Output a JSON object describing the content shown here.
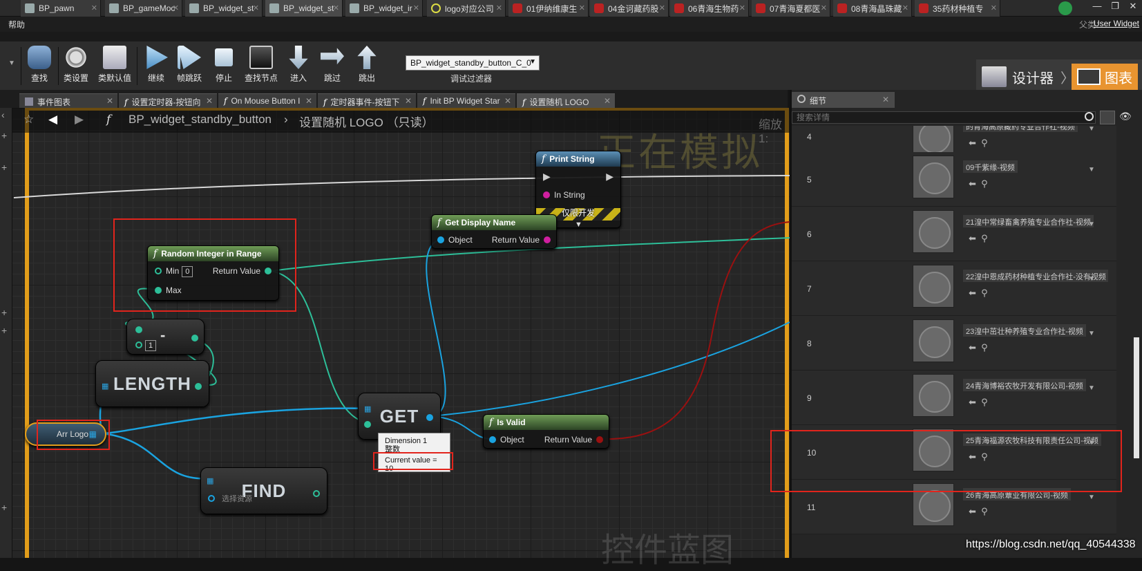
{
  "top_tabs": [
    {
      "label": "BP_pawn",
      "icon": "blueprint-icon"
    },
    {
      "label": "BP_gameMoc",
      "icon": "blueprint-icon"
    },
    {
      "label": "BP_widget_st",
      "icon": "widget-blueprint-icon"
    },
    {
      "label": "BP_widget_st",
      "icon": "widget-blueprint-icon"
    },
    {
      "label": "BP_widget_ir",
      "icon": "widget-blueprint-icon"
    },
    {
      "label": "logo对应公司",
      "icon": "ring-icon"
    },
    {
      "label": "01伊纳维康生",
      "icon": "texture-icon"
    },
    {
      "label": "04金诃藏药股",
      "icon": "texture-icon"
    },
    {
      "label": "06青海生物药",
      "icon": "texture-icon"
    },
    {
      "label": "07青海夏都医",
      "icon": "texture-icon"
    },
    {
      "label": "08青海晶珠藏",
      "icon": "texture-icon"
    },
    {
      "label": "35药材种植专",
      "icon": "texture-icon"
    }
  ],
  "menu": {
    "help": "帮助",
    "parent_label": "父类：",
    "parent_value": "User Widget"
  },
  "toolbar": {
    "buttons": [
      {
        "label": "查找",
        "icon": "binoculars-icon"
      },
      {
        "label": "类设置",
        "icon": "gear-icon"
      },
      {
        "label": "类默认值",
        "icon": "checklist-icon"
      },
      {
        "label": "继续",
        "icon": "play-icon"
      },
      {
        "label": "帧跳跃",
        "icon": "step-frame-icon"
      },
      {
        "label": "停止",
        "icon": "stop-icon"
      },
      {
        "label": "查找节点",
        "icon": "find-node-icon"
      },
      {
        "label": "进入",
        "icon": "step-into-icon"
      },
      {
        "label": "跳过",
        "icon": "step-over-icon"
      },
      {
        "label": "跳出",
        "icon": "step-out-icon"
      }
    ],
    "debug_filter_value": "BP_widget_standby_button_C_0",
    "debug_filter_label": "调试过滤器",
    "mode_designer": "设计器",
    "mode_graph": "图表"
  },
  "doc_tabs": [
    "事件图表",
    "设置定时器-按钮向",
    "On Mouse Button I",
    "定时器事件-按钮下",
    "Init BP Widget Star",
    "设置随机 LOGO"
  ],
  "graph": {
    "breadcrumb_class": "BP_widget_standby_button",
    "breadcrumb_function": "设置随机 LOGO （只读）",
    "zoom": "缩放1:",
    "watermark_simulating": "正在模拟",
    "watermark_bottom": "控件蓝图",
    "nodes": {
      "print_string": {
        "title": "Print String",
        "pin_in": "In String",
        "dev_only": "仅限开发"
      },
      "get_display_name": {
        "title": "Get Display Name",
        "pin_in": "Object",
        "pin_out": "Return Value"
      },
      "random_integer": {
        "title": "Random Integer in Range",
        "pin_min": "Min",
        "min_value": "0",
        "pin_max": "Max",
        "pin_out": "Return Value"
      },
      "subtract": {
        "symbol": "-",
        "value": "1"
      },
      "length": {
        "label": "LENGTH"
      },
      "get": {
        "label": "GET"
      },
      "is_valid": {
        "title": "Is Valid",
        "pin_in": "Object",
        "pin_out": "Return Value"
      },
      "find": {
        "label": "FIND",
        "placeholder": "选择资源"
      },
      "arr_logo": {
        "label": "Arr Logo"
      }
    },
    "tooltip": {
      "line1": "Dimension 1",
      "line2": "整数",
      "current": "Current value = 10"
    }
  },
  "details": {
    "tab": "细节",
    "search_placeholder": "搜索详情",
    "rows": [
      {
        "index": "4",
        "value": "的青海高原藏药专业合作社-视频"
      },
      {
        "index": "5",
        "value": "09千紫缘-视频"
      },
      {
        "index": "6",
        "value": "21湟中常绿畜禽养殖专业合作社-视频"
      },
      {
        "index": "7",
        "value": "22湟中恩成药材种植专业合作社-没有视频"
      },
      {
        "index": "8",
        "value": "23湟中茁壮种养殖专业合作社-视频"
      },
      {
        "index": "9",
        "value": "24青海博裕农牧开发有限公司-视频"
      },
      {
        "index": "10",
        "value": "25青海福源农牧科技有限责任公司-视频"
      },
      {
        "index": "11",
        "value": "26青海高原蕈业有限公司-视频"
      }
    ]
  },
  "url_watermark": "https://blog.csdn.net/qq_40544338",
  "colors": {
    "accent_orange": "#e29d1a",
    "graph_tab": "#e89430",
    "highlight_red": "#e2241c",
    "exec_teal": "#2dbf99",
    "object_blue": "#1aa3e0",
    "bool_red": "#9a1010"
  }
}
